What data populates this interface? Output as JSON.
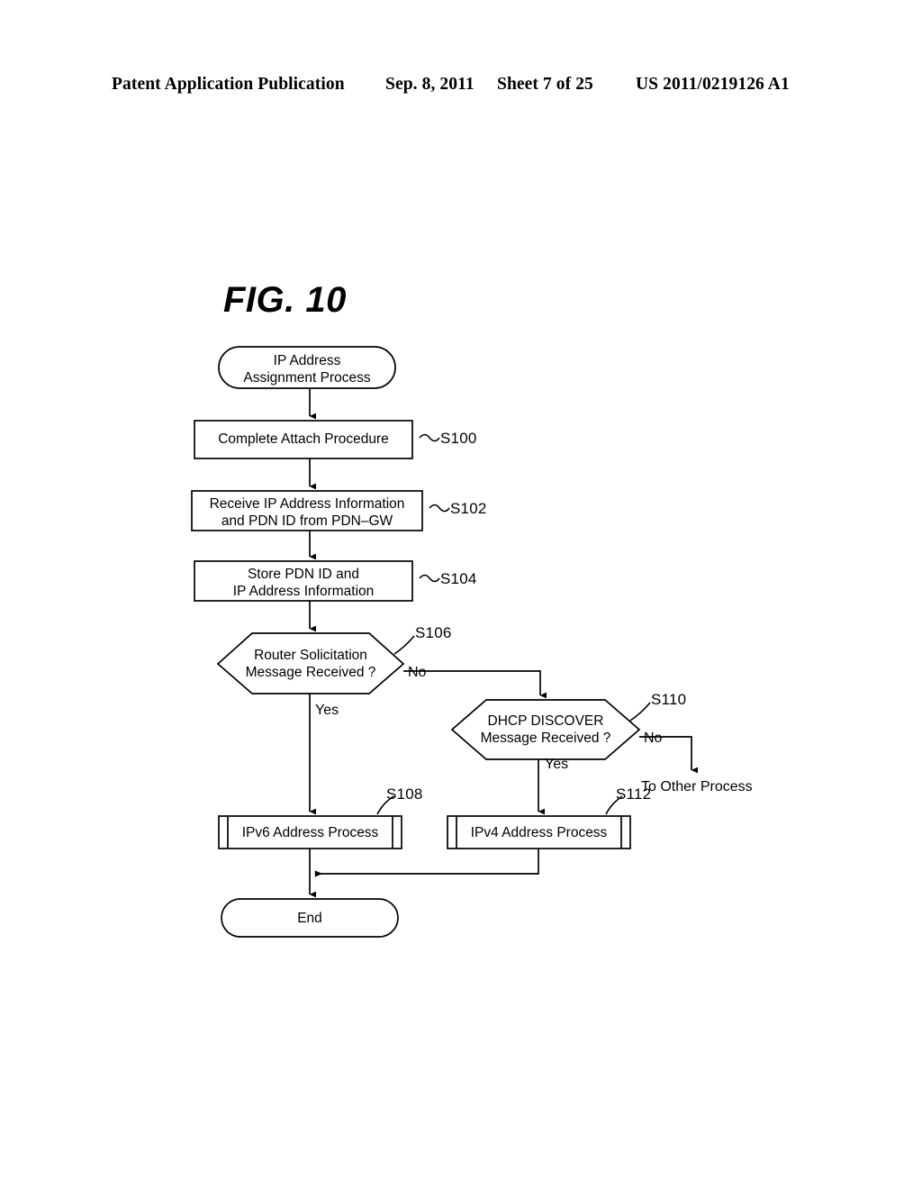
{
  "header": {
    "publication": "Patent Application Publication",
    "date": "Sep. 8, 2011",
    "sheet": "Sheet 7 of 25",
    "doc_number": "US 2011/0219126 A1"
  },
  "figure": {
    "label": "FIG. 10",
    "line_color": "#000000",
    "background": "#ffffff"
  },
  "flowchart": {
    "start": {
      "shape": "terminator",
      "line1": "IP Address",
      "line2": "Assignment Process"
    },
    "steps": [
      {
        "id": "s100",
        "shape": "process",
        "tag": "S100",
        "line1": "Complete Attach Procedure",
        "line2": ""
      },
      {
        "id": "s102",
        "shape": "process",
        "tag": "S102",
        "line1": "Receive IP Address Information",
        "line2": "and PDN ID from PDN–GW"
      },
      {
        "id": "s104",
        "shape": "process",
        "tag": "S104",
        "line1": "Store PDN ID and",
        "line2": "IP Address Information"
      }
    ],
    "decisions": [
      {
        "id": "s106",
        "shape": "hexagon",
        "tag": "S106",
        "line1": "Router Solicitation",
        "line2": "Message Received ?",
        "yes_label": "Yes",
        "no_label": "No"
      },
      {
        "id": "s110",
        "shape": "hexagon",
        "tag": "S110",
        "line1": "DHCP DISCOVER",
        "line2": "Message Received ?",
        "yes_label": "Yes",
        "no_label": "No"
      }
    ],
    "subprocesses": [
      {
        "id": "s108",
        "shape": "predefined-process",
        "tag": "S108",
        "label": "IPv6 Address Process"
      },
      {
        "id": "s112",
        "shape": "predefined-process",
        "tag": "S112",
        "label": "IPv4 Address Process"
      }
    ],
    "offpage": {
      "line1": "To Other",
      "line2": "Process"
    },
    "end": {
      "shape": "terminator",
      "label": "End"
    }
  }
}
